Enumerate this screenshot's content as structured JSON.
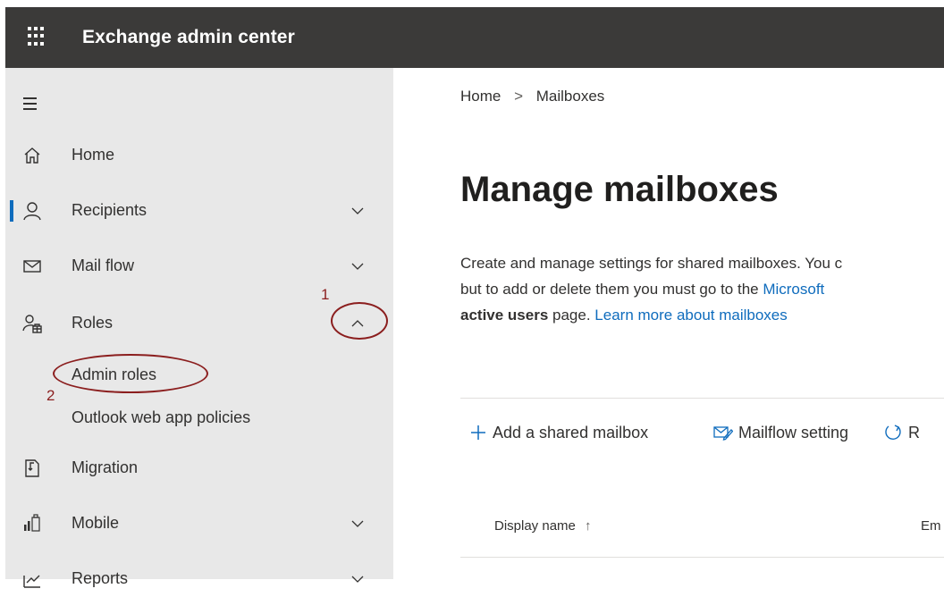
{
  "app": {
    "title": "Exchange admin center"
  },
  "nav": {
    "home": "Home",
    "recipients": "Recipients",
    "mail_flow": "Mail flow",
    "roles": "Roles",
    "admin_roles": "Admin roles",
    "owa_policies": "Outlook web app policies",
    "migration": "Migration",
    "mobile": "Mobile",
    "reports": "Reports"
  },
  "annotations": {
    "one": "1",
    "two": "2"
  },
  "breadcrumb": {
    "home": "Home",
    "current": "Mailboxes"
  },
  "main": {
    "title": "Manage mailboxes",
    "desc_line1": "Create and manage settings for shared mailboxes. You c",
    "desc_line2_a": "but to add or delete them you must go to the ",
    "desc_line2_link": "Microsoft",
    "desc_line3_bold": "active users",
    "desc_line3_text": " page. ",
    "desc_line3_link": "Learn more about mailboxes"
  },
  "toolbar": {
    "add_shared": "Add a shared mailbox",
    "mailflow": "Mailflow setting",
    "refresh": "R"
  },
  "table": {
    "col_display_name": "Display name",
    "sort_arrow": "↑",
    "col_email": "Em"
  },
  "colors": {
    "accent": "#0f6cbd",
    "topbar": "#3b3a39",
    "sidebar": "#e8e8e8",
    "annotation": "#8b1e1e"
  }
}
